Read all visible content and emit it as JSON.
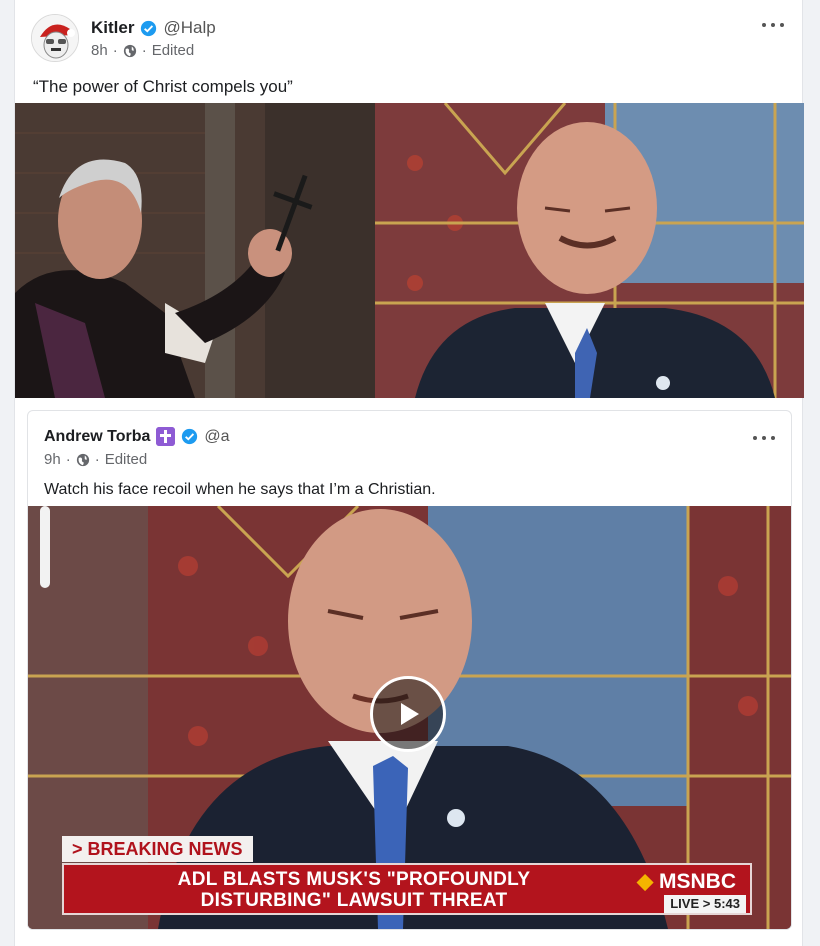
{
  "post": {
    "author": "Kitler",
    "handle": "@Halp",
    "time": "8h",
    "separator": "·",
    "edited": "Edited",
    "text": "“The power of Christ compels you”"
  },
  "quoted_post": {
    "author": "Andrew Torba",
    "handle": "@a",
    "time": "9h",
    "separator": "·",
    "edited": "Edited",
    "text": "Watch his face recoil when he says that I’m a Christian."
  },
  "video_overlay": {
    "breaking_label": "> BREAKING NEWS",
    "headline_line1": "ADL BLASTS MUSK'S \"PROFOUNDLY",
    "headline_line2": "DISTURBING\" LAWSUIT THREAT",
    "network": "MSNBC",
    "live_label": "LIVE",
    "live_arrow": ">",
    "live_time": "5:43"
  },
  "icons": {
    "verified": "verified-badge-icon",
    "globe": "globe-icon",
    "more": "more-options-icon",
    "play": "play-icon",
    "cross_badge": "cross-badge-icon"
  },
  "colors": {
    "verified_blue": "#1d9bf0",
    "cross_badge_purple": "#8e5bd4",
    "breaking_red": "#b3141d"
  }
}
